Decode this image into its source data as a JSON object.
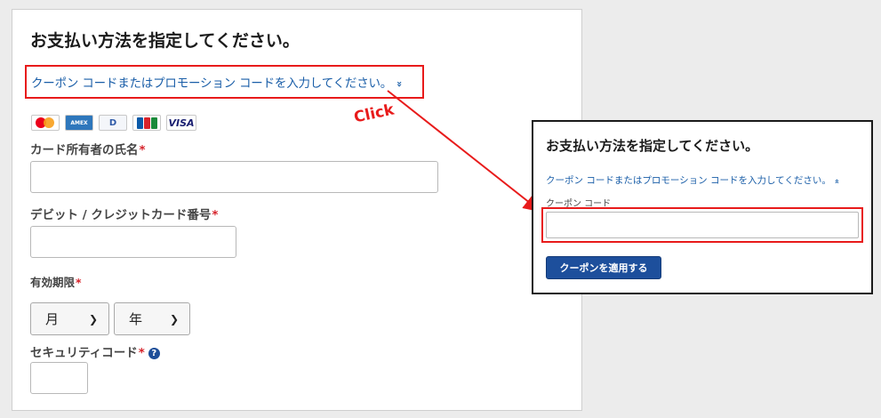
{
  "form": {
    "title": "お支払い方法を指定してください。",
    "promo_link": "クーポン コードまたはプロモーション コードを入力してください。",
    "promo_chevron": "»",
    "cards": [
      {
        "name": "mastercard-icon",
        "text": ""
      },
      {
        "name": "amex-icon",
        "text": "AMEX"
      },
      {
        "name": "diners-icon",
        "text": "D"
      },
      {
        "name": "jcb-icon",
        "text": ""
      },
      {
        "name": "visa-icon",
        "text": "VISA"
      }
    ],
    "cardholder_label": "カード所有者の氏名",
    "card_number_label": "デビット / クレジットカード番号",
    "expiry_label": "有効期限",
    "month_select": "月",
    "year_select": "年",
    "cvc_label": "セキュリティコード",
    "required_mark": "*",
    "help_icon": "?"
  },
  "annotation": {
    "click_text": "Click",
    "color": "#e81b1b"
  },
  "popup": {
    "title": "お支払い方法を指定してください。",
    "promo_link": "クーポン コードまたはプロモーション コードを入力してください。",
    "promo_chevron": "»",
    "coupon_label": "クーポン コード",
    "coupon_input_value": "",
    "apply_button": "クーポンを適用する"
  },
  "colors": {
    "link": "#1a5ea8",
    "button": "#1d4f9c",
    "required": "#d6222a"
  }
}
